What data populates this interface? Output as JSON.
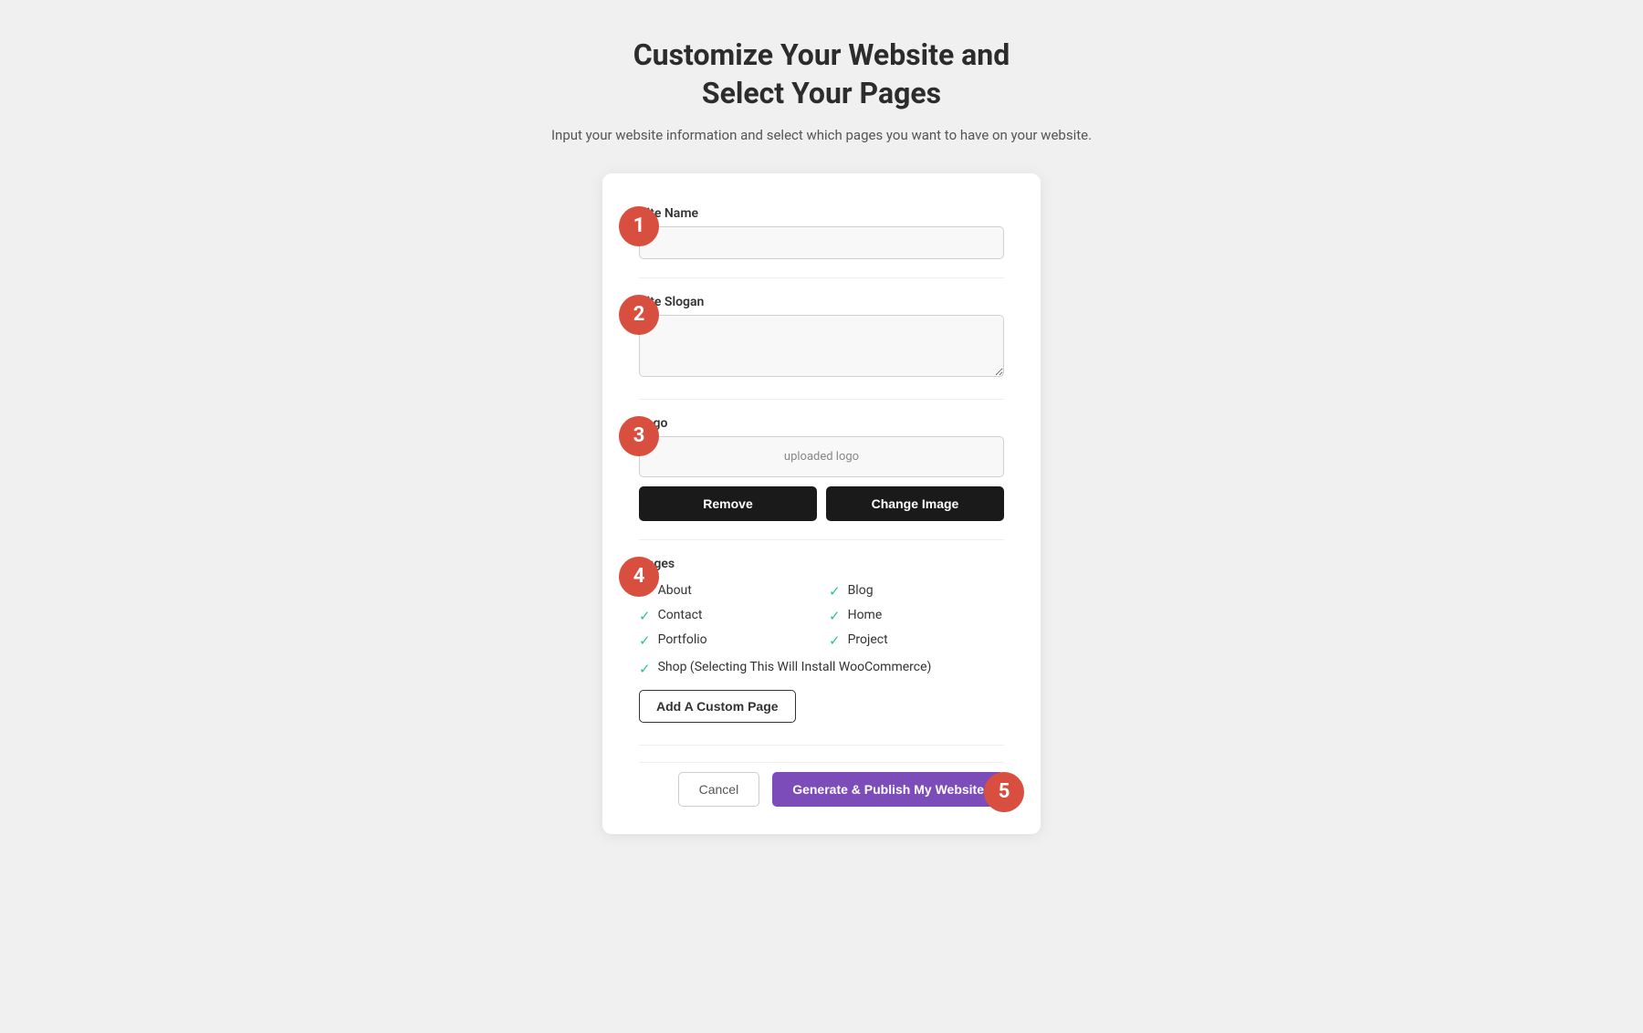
{
  "header": {
    "title_line1": "Customize Your Website and",
    "title_line2": "Select Your Pages",
    "subtitle": "Input your website information and select which pages you want to have on your website."
  },
  "form": {
    "site_name_label": "Site Name",
    "site_name_placeholder": "",
    "site_slogan_label": "Site Slogan",
    "site_slogan_placeholder": "",
    "logo_label": "Logo",
    "logo_preview_alt": "uploaded logo",
    "logo_preview_text": "uploaded logo",
    "remove_button": "Remove",
    "change_image_button": "Change Image",
    "pages_label": "Pages",
    "pages": [
      {
        "label": "About",
        "checked": true
      },
      {
        "label": "Blog",
        "checked": true
      },
      {
        "label": "Contact",
        "checked": true
      },
      {
        "label": "Home",
        "checked": true
      },
      {
        "label": "Portfolio",
        "checked": true
      },
      {
        "label": "Project",
        "checked": true
      }
    ],
    "shop_page_label": "Shop (Selecting This Will Install WooCommerce)",
    "shop_checked": true,
    "add_custom_page_button": "Add A Custom Page",
    "cancel_button": "Cancel",
    "publish_button": "Generate & Publish My Website"
  },
  "steps": {
    "step1": "1",
    "step2": "2",
    "step3": "3",
    "step4": "4",
    "step5": "5"
  }
}
